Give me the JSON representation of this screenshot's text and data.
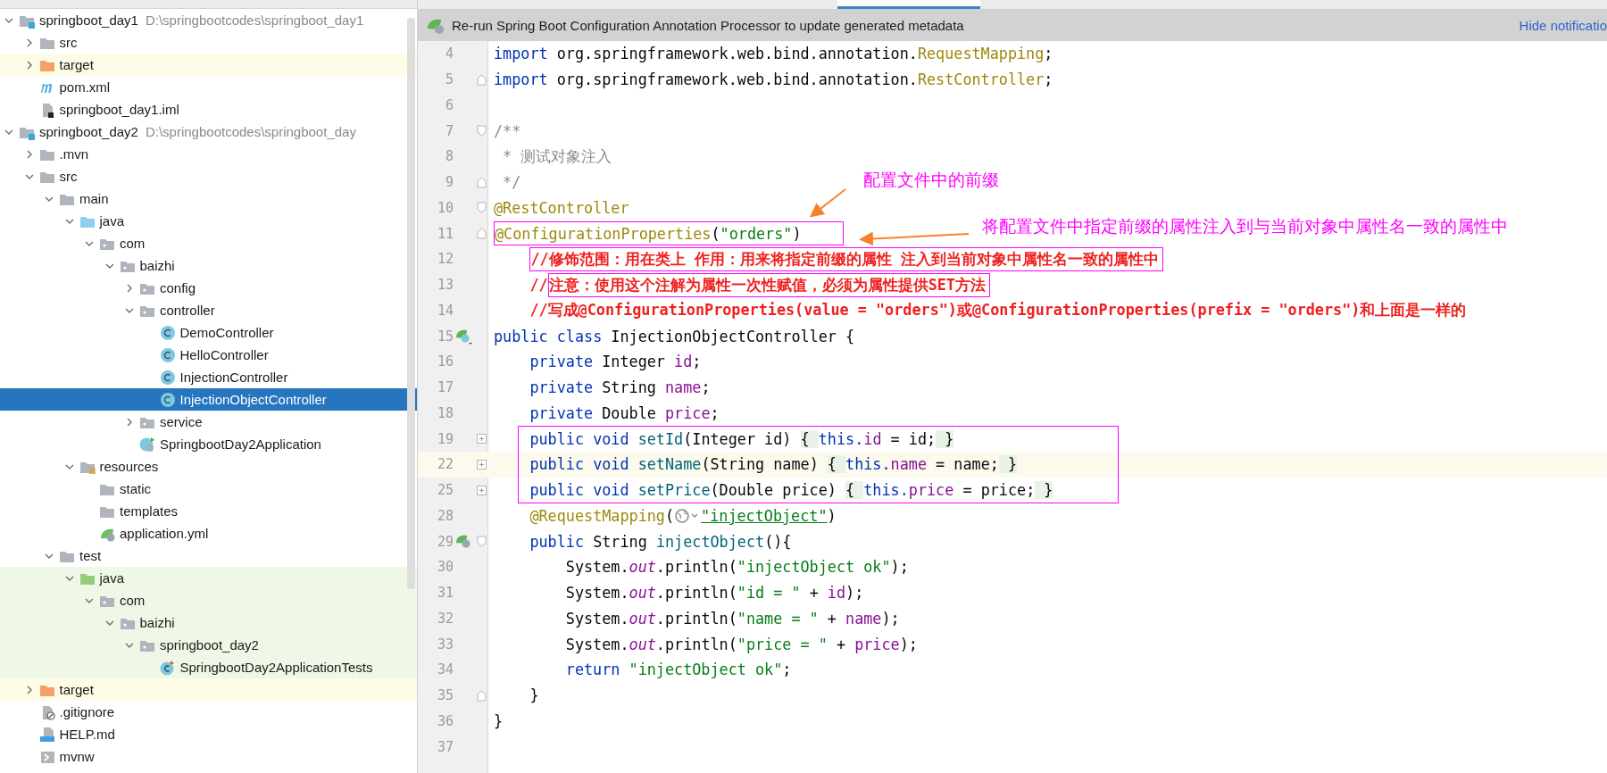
{
  "project_tree": [
    {
      "label": "springboot_day1",
      "path": "D:\\springbootcodes\\springboot_day1",
      "kind": "module",
      "expanded": true,
      "selected": false,
      "excluded": false,
      "test_source": false,
      "children": [
        {
          "label": "src",
          "kind": "folder",
          "expanded": false,
          "selected": false,
          "excluded": false,
          "test_source": false
        },
        {
          "label": "target",
          "kind": "folder",
          "expanded": false,
          "selected": false,
          "excluded": true,
          "test_source": false
        },
        {
          "label": "pom.xml",
          "kind": "maven",
          "selected": false,
          "excluded": false,
          "test_source": false
        },
        {
          "label": "springboot_day1.iml",
          "kind": "iml",
          "selected": false,
          "excluded": false,
          "test_source": false
        }
      ]
    },
    {
      "label": "springboot_day2",
      "path": "D:\\springbootcodes\\springboot_day",
      "kind": "module",
      "expanded": true,
      "selected": false,
      "excluded": false,
      "test_source": false,
      "children": [
        {
          "label": ".mvn",
          "kind": "folder",
          "expanded": false,
          "selected": false,
          "excluded": false,
          "test_source": false
        },
        {
          "label": "src",
          "kind": "folder",
          "expanded": true,
          "selected": false,
          "excluded": false,
          "test_source": false,
          "children": [
            {
              "label": "main",
              "kind": "folder",
              "expanded": true,
              "selected": false,
              "excluded": false,
              "test_source": false,
              "children": [
                {
                  "label": "java",
                  "kind": "source-root",
                  "expanded": true,
                  "selected": false,
                  "excluded": false,
                  "test_source": false,
                  "children": [
                    {
                      "label": "com",
                      "kind": "package",
                      "expanded": true,
                      "selected": false,
                      "excluded": false,
                      "test_source": false,
                      "children": [
                        {
                          "label": "baizhi",
                          "kind": "package",
                          "expanded": true,
                          "selected": false,
                          "excluded": false,
                          "test_source": false,
                          "children": [
                            {
                              "label": "config",
                              "kind": "package",
                              "expanded": false,
                              "selected": false,
                              "excluded": false,
                              "test_source": false
                            },
                            {
                              "label": "controller",
                              "kind": "package",
                              "expanded": true,
                              "selected": false,
                              "excluded": false,
                              "test_source": false,
                              "children": [
                                {
                                  "label": "DemoController",
                                  "kind": "class",
                                  "selected": false,
                                  "excluded": false,
                                  "test_source": false
                                },
                                {
                                  "label": "HelloController",
                                  "kind": "class",
                                  "selected": false,
                                  "excluded": false,
                                  "test_source": false
                                },
                                {
                                  "label": "InjectionController",
                                  "kind": "class",
                                  "selected": false,
                                  "excluded": false,
                                  "test_source": false
                                },
                                {
                                  "label": "InjectionObjectController",
                                  "kind": "class",
                                  "selected": true,
                                  "excluded": false,
                                  "test_source": false
                                }
                              ]
                            },
                            {
                              "label": "service",
                              "kind": "package",
                              "expanded": false,
                              "selected": false,
                              "excluded": false,
                              "test_source": false
                            },
                            {
                              "label": "SpringbootDay2Application",
                              "kind": "spring-class",
                              "selected": false,
                              "excluded": false,
                              "test_source": false
                            }
                          ]
                        }
                      ]
                    }
                  ]
                },
                {
                  "label": "resources",
                  "kind": "resources-root",
                  "expanded": true,
                  "selected": false,
                  "excluded": false,
                  "test_source": false,
                  "children": [
                    {
                      "label": "static",
                      "kind": "folder",
                      "selected": false,
                      "excluded": false,
                      "test_source": false
                    },
                    {
                      "label": "templates",
                      "kind": "folder",
                      "selected": false,
                      "excluded": false,
                      "test_source": false
                    },
                    {
                      "label": "application.yml",
                      "kind": "spring-config",
                      "selected": false,
                      "excluded": false,
                      "test_source": false
                    }
                  ]
                }
              ]
            },
            {
              "label": "test",
              "kind": "folder",
              "expanded": true,
              "selected": false,
              "excluded": false,
              "test_source": false,
              "children": [
                {
                  "label": "java",
                  "kind": "test-root",
                  "expanded": true,
                  "selected": false,
                  "excluded": false,
                  "test_source": true,
                  "children": [
                    {
                      "label": "com",
                      "kind": "package",
                      "expanded": true,
                      "selected": false,
                      "excluded": false,
                      "test_source": true,
                      "children": [
                        {
                          "label": "baizhi",
                          "kind": "package",
                          "expanded": true,
                          "selected": false,
                          "excluded": false,
                          "test_source": true,
                          "children": [
                            {
                              "label": "springboot_day2",
                              "kind": "package",
                              "expanded": true,
                              "selected": false,
                              "excluded": false,
                              "test_source": true,
                              "children": [
                                {
                                  "label": "SpringbootDay2ApplicationTests",
                                  "kind": "test-class",
                                  "selected": false,
                                  "excluded": false,
                                  "test_source": true
                                }
                              ]
                            }
                          ]
                        }
                      ]
                    }
                  ]
                }
              ]
            }
          ]
        },
        {
          "label": "target",
          "kind": "folder",
          "expanded": false,
          "selected": false,
          "excluded": true,
          "test_source": false
        },
        {
          "label": ".gitignore",
          "kind": "ignore",
          "selected": false,
          "excluded": false,
          "test_source": false
        },
        {
          "label": "HELP.md",
          "kind": "markdown",
          "selected": false,
          "excluded": false,
          "test_source": false
        },
        {
          "label": "mvnw",
          "kind": "script",
          "selected": false,
          "excluded": false,
          "test_source": false
        }
      ]
    }
  ],
  "notification": {
    "text": "Re-run Spring Boot Configuration Annotation Processor to update generated metadata",
    "action": "Hide notificatio"
  },
  "code_lines": [
    {
      "number": "4",
      "kind": "top",
      "tokens": [
        {
          "kind": "kw",
          "t": "import "
        },
        {
          "kind": "plain",
          "t": "org.springframework.web.bind.annotation."
        },
        {
          "kind": "ann",
          "t": "RequestMapping"
        },
        {
          "kind": "plain",
          "t": ";"
        }
      ]
    },
    {
      "number": "5",
      "kind": "top",
      "fold": {
        "kind": "end"
      },
      "tokens": [
        {
          "kind": "kw",
          "t": "import "
        },
        {
          "kind": "plain",
          "t": "org.springframework.web.bind.annotation."
        },
        {
          "kind": "ann",
          "t": "RestController"
        },
        {
          "kind": "plain",
          "t": ";"
        }
      ]
    },
    {
      "number": "6"
    },
    {
      "number": "7",
      "kind": "top",
      "fold": {
        "kind": "start"
      },
      "tokens": [
        {
          "kind": "comment",
          "t": "/**"
        }
      ]
    },
    {
      "number": "8",
      "kind": "top",
      "tokens": [
        {
          "kind": "comment",
          "t": " * 测试对象注入"
        }
      ]
    },
    {
      "number": "9",
      "kind": "top",
      "fold": {
        "kind": "end"
      },
      "tokens": [
        {
          "kind": "comment",
          "t": " */"
        }
      ]
    },
    {
      "number": "10",
      "kind": "top",
      "fold": {
        "kind": "start"
      },
      "tokens": [
        {
          "kind": "ann",
          "t": "@RestController"
        }
      ]
    },
    {
      "number": "11",
      "kind": "top",
      "fold": {
        "kind": "end"
      },
      "tokens": [
        {
          "kind": "box",
          "parts": [
            {
              "kind": "ann",
              "t": "@ConfigurationProperties"
            },
            {
              "kind": "plain",
              "t": "("
            },
            {
              "kind": "str",
              "t": "\"orders\""
            },
            {
              "kind": "plain",
              "t": ")"
            }
          ]
        }
      ]
    },
    {
      "number": "12",
      "kind": "member",
      "tokens": [
        {
          "kind": "box",
          "parts": [
            {
              "kind": "note",
              "t": "//修饰范围：用在类上 作用：用来将指定前缀的属性 注入到当前对象中属性名一致的属性中"
            }
          ]
        }
      ]
    },
    {
      "number": "13",
      "kind": "member",
      "tokens": [
        {
          "kind": "note",
          "t": "//"
        },
        {
          "kind": "box",
          "parts": [
            {
              "kind": "note",
              "t": "注意：使用这个注解为属性一次性赋值，必须为属性提供SET方法"
            }
          ]
        }
      ]
    },
    {
      "number": "14",
      "kind": "member",
      "tokens": [
        {
          "kind": "note",
          "t": "//写成@ConfigurationProperties(value = \"orders\")或@ConfigurationProperties(prefix = \"orders\")和上面是一样的"
        }
      ]
    },
    {
      "number": "15",
      "kind": "top",
      "gutter": {
        "kind": "bean"
      },
      "tokens": [
        {
          "kind": "kw",
          "t": "public class "
        },
        {
          "kind": "plain",
          "t": "InjectionObjectController {"
        }
      ]
    },
    {
      "number": "16",
      "kind": "member",
      "tokens": [
        {
          "kind": "kw",
          "t": "private "
        },
        {
          "kind": "plain",
          "t": "Integer "
        },
        {
          "kind": "field",
          "t": "id"
        },
        {
          "kind": "plain",
          "t": ";"
        }
      ]
    },
    {
      "number": "17",
      "kind": "member",
      "tokens": [
        {
          "kind": "kw",
          "t": "private "
        },
        {
          "kind": "plain",
          "t": "String "
        },
        {
          "kind": "field",
          "t": "name"
        },
        {
          "kind": "plain",
          "t": ";"
        }
      ]
    },
    {
      "number": "18",
      "kind": "member",
      "tokens": [
        {
          "kind": "kw",
          "t": "private "
        },
        {
          "kind": "plain",
          "t": "Double "
        },
        {
          "kind": "field",
          "t": "price"
        },
        {
          "kind": "plain",
          "t": ";"
        }
      ]
    },
    {
      "number": "19",
      "kind": "member",
      "fold": {
        "kind": "collapsed"
      },
      "in_box": true,
      "current": false,
      "tokens": [
        {
          "kind": "kw",
          "t": "public void "
        },
        {
          "kind": "method",
          "t": "setId"
        },
        {
          "kind": "plain",
          "t": "(Integer id) "
        },
        {
          "kind": "folded",
          "t": "{ "
        },
        {
          "kind": "kw",
          "t": "this."
        },
        {
          "kind": "field",
          "t": "id"
        },
        {
          "kind": "plain",
          "t": " = id;"
        },
        {
          "kind": "folded",
          "t": " }"
        }
      ]
    },
    {
      "number": "22",
      "kind": "member",
      "fold": {
        "kind": "collapsed"
      },
      "in_box": true,
      "current": true,
      "tokens": [
        {
          "kind": "kw",
          "t": "public void "
        },
        {
          "kind": "method",
          "t": "setName"
        },
        {
          "kind": "plain",
          "t": "(String name) "
        },
        {
          "kind": "folded",
          "t": "{ "
        },
        {
          "kind": "kw",
          "t": "this."
        },
        {
          "kind": "field",
          "t": "name"
        },
        {
          "kind": "plain",
          "t": " = name;"
        },
        {
          "kind": "folded",
          "t": " }"
        }
      ]
    },
    {
      "number": "25",
      "kind": "member",
      "fold": {
        "kind": "collapsed"
      },
      "in_box": true,
      "current": false,
      "tokens": [
        {
          "kind": "kw",
          "t": "public void "
        },
        {
          "kind": "method",
          "t": "setPrice"
        },
        {
          "kind": "plain",
          "t": "(Double price) "
        },
        {
          "kind": "folded",
          "t": "{ "
        },
        {
          "kind": "kw",
          "t": "this."
        },
        {
          "kind": "field",
          "t": "price"
        },
        {
          "kind": "plain",
          "t": " = price;"
        },
        {
          "kind": "folded",
          "t": " }"
        }
      ]
    },
    {
      "number": "28",
      "kind": "member",
      "tokens": [
        {
          "kind": "ann",
          "t": "@RequestMapping"
        },
        {
          "kind": "plain",
          "t": "("
        },
        {
          "kind": "url-icon"
        },
        {
          "kind": "link",
          "t": "\"injectObject\""
        },
        {
          "kind": "plain",
          "t": ")"
        }
      ]
    },
    {
      "number": "29",
      "kind": "member",
      "gutter": {
        "kind": "bean-web"
      },
      "fold": {
        "kind": "start"
      },
      "tokens": [
        {
          "kind": "kw",
          "t": "public "
        },
        {
          "kind": "plain",
          "t": "String "
        },
        {
          "kind": "method",
          "t": "injectObject"
        },
        {
          "kind": "plain",
          "t": "(){"
        }
      ]
    },
    {
      "number": "30",
      "kind": "statement",
      "tokens": [
        {
          "kind": "plain",
          "t": "System."
        },
        {
          "kind": "static",
          "t": "out"
        },
        {
          "kind": "plain",
          "t": ".println("
        },
        {
          "kind": "str",
          "t": "\"injectObject ok\""
        },
        {
          "kind": "plain",
          "t": ");"
        }
      ]
    },
    {
      "number": "31",
      "kind": "statement",
      "tokens": [
        {
          "kind": "plain",
          "t": "System."
        },
        {
          "kind": "static",
          "t": "out"
        },
        {
          "kind": "plain",
          "t": ".println("
        },
        {
          "kind": "str",
          "t": "\"id = \""
        },
        {
          "kind": "plain",
          "t": " + "
        },
        {
          "kind": "field",
          "t": "id"
        },
        {
          "kind": "plain",
          "t": ");"
        }
      ]
    },
    {
      "number": "32",
      "kind": "statement",
      "tokens": [
        {
          "kind": "plain",
          "t": "System."
        },
        {
          "kind": "static",
          "t": "out"
        },
        {
          "kind": "plain",
          "t": ".println("
        },
        {
          "kind": "str",
          "t": "\"name = \""
        },
        {
          "kind": "plain",
          "t": " + "
        },
        {
          "kind": "field",
          "t": "name"
        },
        {
          "kind": "plain",
          "t": ");"
        }
      ]
    },
    {
      "number": "33",
      "kind": "statement",
      "tokens": [
        {
          "kind": "plain",
          "t": "System."
        },
        {
          "kind": "static",
          "t": "out"
        },
        {
          "kind": "plain",
          "t": ".println("
        },
        {
          "kind": "str",
          "t": "\"price = \""
        },
        {
          "kind": "plain",
          "t": " + "
        },
        {
          "kind": "field",
          "t": "price"
        },
        {
          "kind": "plain",
          "t": ");"
        }
      ]
    },
    {
      "number": "34",
      "kind": "statement",
      "tokens": [
        {
          "kind": "kw",
          "t": "return "
        },
        {
          "kind": "str",
          "t": "\"injectObject ok\""
        },
        {
          "kind": "plain",
          "t": ";"
        }
      ]
    },
    {
      "number": "35",
      "kind": "member",
      "fold": {
        "kind": "end"
      },
      "tokens": [
        {
          "kind": "plain",
          "t": "}"
        }
      ]
    },
    {
      "number": "36",
      "kind": "top",
      "tokens": [
        {
          "kind": "plain",
          "t": "}"
        }
      ]
    },
    {
      "number": "37"
    }
  ],
  "callouts": [
    {
      "text": "配置文件中的前缀"
    },
    {
      "text": "将配置文件中指定前缀的属性注入到与当前对象中属性名一致的属性中"
    }
  ]
}
